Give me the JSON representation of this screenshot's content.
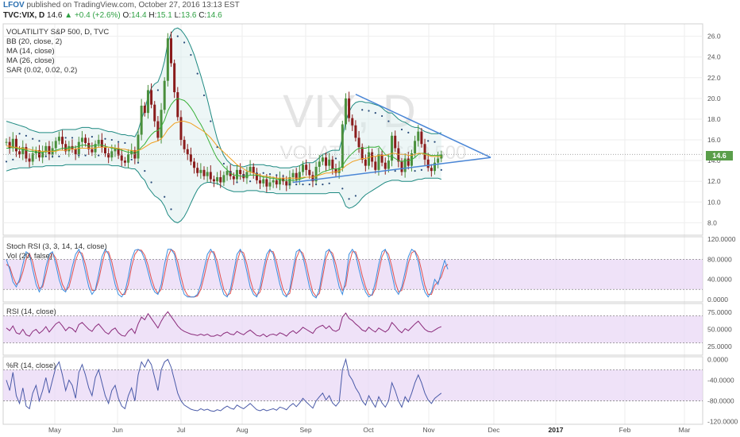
{
  "header": {
    "user": "LFOV",
    "published": "published on TradingView.com, October 27, 2016 13:13 EST",
    "symbol": "TVC:VIX, D",
    "last": "14.6",
    "change": "+0.4 (+2.6%)",
    "ohlc": {
      "o": "14.4",
      "h": "15.1",
      "l": "13.6",
      "c": "14.6"
    },
    "labels": {
      "o": "O:",
      "h": "H:",
      "l": "L:",
      "c": "C:"
    }
  },
  "main_pane": {
    "indicators": [
      "VOLATILITY S&P 500, D, TVC",
      "BB (20, close, 2)",
      "MA (14, close)",
      "MA (26, close)",
      "SAR (0.02, 0.02, 0.2)"
    ],
    "watermark": "VIX, D",
    "watermark_sub": "VOLATILITY S&P 500",
    "price_label": "14.6"
  },
  "stoch_pane": {
    "indicators": [
      "Stoch RSI (3, 3, 14, 14, close)",
      "Vol (20, false)"
    ]
  },
  "rsi_pane": {
    "indicators": [
      "RSI (14, close)"
    ]
  },
  "wr_pane": {
    "indicators": [
      "%R (14, close)"
    ]
  },
  "chart_data": [
    {
      "type": "candlestick",
      "title": "VOLATILITY S&P 500, D, TVC",
      "x_ticks": [
        "May",
        "Jun",
        "Jul",
        "Aug",
        "Sep",
        "Oct",
        "Nov",
        "Dec",
        "2017",
        "Feb",
        "Mar"
      ],
      "y_ticks": [
        "8.0",
        "10.0",
        "12.0",
        "14.0",
        "16.0",
        "18.0",
        "20.0",
        "22.0",
        "24.0",
        "26.0"
      ],
      "ylim": [
        6.8,
        27.2
      ],
      "close": [
        15.8,
        15.2,
        16.1,
        14.9,
        14.6,
        15.3,
        14.2,
        13.9,
        14.7,
        15.0,
        14.3,
        14.8,
        15.4,
        14.6,
        15.2,
        15.9,
        16.3,
        15.6,
        14.9,
        15.4,
        15.1,
        14.6,
        15.8,
        16.2,
        15.7,
        15.1,
        14.8,
        15.6,
        16.0,
        15.3,
        14.7,
        14.3,
        14.9,
        15.2,
        14.5,
        14.0,
        13.8,
        14.6,
        15.0,
        14.2,
        16.5,
        19.3,
        18.6,
        20.8,
        19.4,
        17.8,
        16.2,
        18.9,
        21.7,
        25.8,
        23.4,
        20.6,
        18.2,
        16.0,
        15.1,
        14.6,
        13.9,
        13.3,
        12.8,
        13.1,
        12.5,
        12.9,
        12.2,
        12.0,
        12.4,
        11.9,
        12.6,
        13.0,
        12.5,
        12.2,
        13.1,
        12.7,
        12.3,
        12.9,
        13.4,
        12.8,
        12.1,
        11.8,
        12.2,
        11.5,
        11.9,
        12.1,
        11.7,
        12.3,
        12.0,
        11.6,
        12.4,
        12.8,
        12.2,
        12.9,
        13.6,
        13.1,
        12.6,
        12.0,
        13.4,
        13.9,
        14.3,
        13.5,
        14.1,
        13.2,
        12.8,
        13.3,
        17.5,
        20.0,
        18.1,
        17.4,
        16.2,
        15.3,
        14.1,
        13.5,
        14.8,
        13.9,
        13.1,
        14.6,
        13.8,
        13.2,
        14.0,
        16.4,
        15.2,
        13.9,
        12.9,
        14.2,
        13.5,
        14.7,
        15.9,
        16.8,
        15.6,
        14.1,
        13.3,
        13.0,
        13.8,
        14.2,
        14.6
      ],
      "ma14": [
        15.2,
        15.2,
        15.3,
        15.2,
        15.1,
        15.1,
        15.0,
        14.9,
        14.9,
        14.8,
        14.8,
        14.8,
        14.9,
        14.9,
        14.9,
        15.0,
        15.1,
        15.2,
        15.2,
        15.2,
        15.3,
        15.3,
        15.4,
        15.5,
        15.5,
        15.4,
        15.4,
        15.5,
        15.5,
        15.5,
        15.4,
        15.3,
        15.2,
        15.2,
        15.1,
        15.0,
        14.9,
        14.8,
        14.8,
        14.7,
        14.9,
        15.3,
        15.6,
        16.1,
        16.5,
        16.8,
        16.9,
        17.3,
        17.9,
        18.8,
        19.4,
        19.8,
        20.0,
        19.9,
        19.8,
        19.5,
        19.1,
        18.6,
        18.0,
        17.5,
        16.9,
        16.2,
        15.5,
        14.8,
        14.2,
        13.8,
        13.4,
        13.1,
        12.8,
        12.6,
        12.6,
        12.5,
        12.5,
        12.5,
        12.6,
        12.6,
        12.6,
        12.5,
        12.4,
        12.4,
        12.3,
        12.3,
        12.2,
        12.2,
        12.1,
        12.1,
        12.1,
        12.1,
        12.1,
        12.2,
        12.3,
        12.4,
        12.4,
        12.4,
        12.5,
        12.7,
        12.9,
        13.0,
        13.1,
        13.2,
        13.2,
        13.2,
        13.5,
        14.0,
        14.4,
        14.7,
        15.0,
        15.2,
        15.2,
        15.2,
        15.3,
        15.3,
        15.3,
        15.4,
        15.0,
        14.6,
        14.4,
        14.4,
        14.2,
        14.0,
        13.9,
        14.0,
        14.0,
        14.1,
        14.3,
        14.6,
        14.7,
        14.7,
        14.6,
        14.5,
        14.5,
        14.5,
        14.5
      ],
      "ma26": [
        15.4,
        15.4,
        15.3,
        15.3,
        15.2,
        15.2,
        15.1,
        15.1,
        15.0,
        15.0,
        14.9,
        14.9,
        14.9,
        14.9,
        14.9,
        14.9,
        15.0,
        15.0,
        15.0,
        15.1,
        15.1,
        15.1,
        15.2,
        15.2,
        15.2,
        15.2,
        15.2,
        15.2,
        15.3,
        15.3,
        15.3,
        15.3,
        15.3,
        15.2,
        15.2,
        15.1,
        15.1,
        15.0,
        15.0,
        14.9,
        15.0,
        15.1,
        15.3,
        15.5,
        15.7,
        15.8,
        15.9,
        16.1,
        16.5,
        17.0,
        17.3,
        17.6,
        17.7,
        17.8,
        17.8,
        17.7,
        17.6,
        17.4,
        17.2,
        17.0,
        16.8,
        16.5,
        16.2,
        15.8,
        15.4,
        15.1,
        14.8,
        14.5,
        14.2,
        13.9,
        13.6,
        13.4,
        13.2,
        13.0,
        12.9,
        12.8,
        12.7,
        12.6,
        12.5,
        12.5,
        12.4,
        12.4,
        12.3,
        12.3,
        12.3,
        12.3,
        12.3,
        12.3,
        12.3,
        12.3,
        12.4,
        12.4,
        12.4,
        12.4,
        12.5,
        12.6,
        12.7,
        12.8,
        12.8,
        12.9,
        12.9,
        13.0,
        13.2,
        13.5,
        13.7,
        13.9,
        14.0,
        14.1,
        14.2,
        14.2,
        14.3,
        14.4,
        14.4,
        14.5,
        14.5,
        14.5,
        14.6,
        14.7,
        14.7,
        14.6,
        14.6,
        14.6,
        14.5,
        14.5,
        14.6,
        14.7,
        14.7,
        14.6,
        14.5,
        14.4,
        14.4,
        14.4,
        14.4
      ],
      "bb_upper": [
        17.8,
        17.7,
        17.6,
        17.5,
        17.4,
        17.3,
        17.2,
        17.0,
        16.9,
        16.8,
        16.7,
        16.7,
        16.7,
        16.7,
        16.7,
        16.8,
        16.9,
        17.0,
        17.0,
        17.0,
        17.0,
        17.0,
        17.1,
        17.2,
        17.2,
        17.2,
        17.1,
        17.1,
        17.1,
        17.0,
        16.9,
        16.8,
        16.8,
        16.7,
        16.6,
        16.5,
        16.5,
        16.4,
        16.4,
        16.3,
        16.9,
        18.0,
        18.9,
        20.2,
        21.0,
        21.4,
        21.6,
        22.4,
        23.6,
        25.4,
        26.3,
        26.7,
        26.8,
        26.6,
        26.2,
        25.7,
        25.0,
        24.2,
        23.2,
        22.2,
        21.1,
        19.9,
        18.6,
        17.3,
        16.1,
        15.2,
        14.5,
        14.0,
        13.7,
        13.5,
        13.5,
        13.4,
        13.4,
        13.5,
        13.6,
        13.6,
        13.6,
        13.6,
        13.6,
        13.5,
        13.5,
        13.4,
        13.4,
        13.3,
        13.3,
        13.3,
        13.3,
        13.4,
        13.4,
        13.5,
        13.7,
        13.8,
        13.8,
        13.8,
        14.0,
        14.3,
        14.6,
        14.7,
        14.9,
        15.0,
        15.0,
        15.0,
        16.2,
        17.8,
        18.7,
        19.3,
        19.6,
        19.7,
        19.7,
        19.6,
        19.6,
        19.5,
        19.4,
        19.3,
        19.1,
        18.8,
        18.6,
        18.6,
        18.3,
        18.0,
        17.8,
        17.7,
        17.5,
        17.3,
        17.2,
        17.2,
        17.0,
        16.8,
        16.7,
        16.6,
        16.6,
        16.6,
        16.7
      ],
      "bb_lower": [
        13.0,
        13.1,
        13.2,
        13.2,
        13.3,
        13.3,
        13.3,
        13.3,
        13.4,
        13.4,
        13.4,
        13.4,
        13.5,
        13.5,
        13.5,
        13.5,
        13.5,
        13.5,
        13.6,
        13.6,
        13.6,
        13.6,
        13.6,
        13.6,
        13.6,
        13.6,
        13.6,
        13.6,
        13.6,
        13.6,
        13.6,
        13.6,
        13.5,
        13.5,
        13.5,
        13.4,
        13.3,
        13.3,
        13.2,
        13.2,
        12.9,
        12.4,
        12.1,
        11.4,
        11.0,
        10.6,
        10.4,
        10.1,
        9.6,
        8.8,
        8.4,
        8.1,
        8.0,
        8.2,
        8.6,
        9.2,
        9.9,
        10.6,
        11.2,
        11.6,
        11.8,
        11.9,
        11.9,
        11.8,
        11.8,
        11.6,
        11.4,
        11.2,
        11.1,
        11.0,
        11.0,
        11.0,
        11.0,
        11.1,
        11.1,
        11.1,
        11.1,
        11.0,
        11.0,
        10.9,
        10.9,
        10.9,
        10.8,
        10.8,
        10.8,
        10.8,
        10.8,
        10.8,
        10.8,
        10.8,
        10.8,
        10.8,
        10.8,
        10.8,
        10.8,
        10.8,
        10.8,
        10.8,
        10.9,
        10.9,
        10.9,
        10.9,
        10.4,
        9.6,
        9.4,
        9.5,
        9.7,
        10.0,
        10.4,
        10.7,
        10.9,
        11.1,
        11.3,
        11.5,
        11.7,
        11.9,
        12.0,
        12.1,
        12.1,
        12.1,
        12.0,
        12.0,
        12.0,
        12.0,
        12.1,
        12.2,
        12.2,
        12.3,
        12.3,
        12.3,
        12.3,
        12.3,
        12.2
      ],
      "triangle": [
        {
          "from": [
            106,
            20.4
          ],
          "to": [
            147,
            14.3
          ]
        },
        {
          "from": [
            87,
            11.9
          ],
          "to": [
            147,
            14.3
          ]
        }
      ]
    },
    {
      "type": "line",
      "title": "Stoch RSI (3, 3, 14, 14, close)",
      "y_ticks": [
        "0.0000",
        "40.0000",
        "80.0000",
        "120.0000"
      ],
      "ylim": [
        -5,
        125
      ],
      "bands": [
        20,
        80
      ],
      "k": [
        80,
        60,
        35,
        25,
        40,
        70,
        95,
        90,
        60,
        30,
        15,
        30,
        65,
        90,
        95,
        70,
        40,
        20,
        15,
        35,
        65,
        90,
        100,
        85,
        55,
        25,
        10,
        20,
        50,
        85,
        100,
        90,
        60,
        30,
        10,
        5,
        15,
        45,
        80,
        98,
        100,
        95,
        80,
        55,
        30,
        15,
        10,
        30,
        70,
        100,
        100,
        90,
        60,
        30,
        10,
        5,
        5,
        5,
        10,
        30,
        60,
        90,
        100,
        90,
        60,
        30,
        10,
        5,
        20,
        55,
        90,
        100,
        85,
        55,
        25,
        10,
        5,
        25,
        60,
        90,
        100,
        90,
        60,
        30,
        10,
        5,
        20,
        60,
        95,
        100,
        85,
        55,
        25,
        8,
        3,
        20,
        60,
        95,
        100,
        85,
        55,
        25,
        10,
        40,
        90,
        100,
        90,
        60,
        35,
        15,
        5,
        10,
        35,
        70,
        95,
        100,
        80,
        50,
        20,
        10,
        25,
        55,
        85,
        100,
        95,
        75,
        40,
        15,
        5,
        15,
        40,
        30,
        55,
        78,
        60
      ],
      "d": [
        70,
        65,
        45,
        30,
        35,
        55,
        80,
        92,
        75,
        45,
        22,
        25,
        50,
        80,
        93,
        82,
        55,
        30,
        18,
        25,
        50,
        78,
        95,
        92,
        70,
        40,
        18,
        18,
        38,
        70,
        95,
        95,
        75,
        45,
        20,
        10,
        10,
        30,
        65,
        90,
        99,
        98,
        88,
        68,
        42,
        22,
        12,
        20,
        50,
        85,
        100,
        95,
        75,
        45,
        20,
        8,
        5,
        5,
        7,
        20,
        45,
        75,
        95,
        95,
        75,
        45,
        20,
        8,
        12,
        40,
        75,
        97,
        93,
        70,
        40,
        17,
        8,
        15,
        45,
        78,
        97,
        95,
        75,
        45,
        20,
        8,
        12,
        45,
        82,
        98,
        92,
        70,
        40,
        15,
        6,
        12,
        45,
        82,
        98,
        92,
        70,
        40,
        18,
        28,
        70,
        95,
        95,
        75,
        48,
        25,
        10,
        8,
        22,
        55,
        85,
        98,
        90,
        65,
        35,
        15,
        18,
        42,
        72,
        93,
        97,
        85,
        58,
        28,
        10,
        10,
        28,
        35,
        45,
        65,
        70
      ]
    },
    {
      "type": "line",
      "title": "RSI (14, close)",
      "y_ticks": [
        "25.0000",
        "50.0000",
        "75.0000"
      ],
      "ylim": [
        12,
        88
      ],
      "bands": [
        30,
        70
      ],
      "values": [
        52,
        48,
        55,
        45,
        43,
        50,
        42,
        40,
        47,
        50,
        44,
        48,
        54,
        46,
        52,
        58,
        61,
        55,
        48,
        53,
        51,
        46,
        57,
        60,
        55,
        50,
        47,
        54,
        58,
        52,
        46,
        43,
        49,
        52,
        45,
        41,
        40,
        47,
        51,
        44,
        58,
        68,
        64,
        73,
        66,
        59,
        52,
        62,
        70,
        76,
        69,
        62,
        55,
        50,
        47,
        45,
        43,
        42,
        41,
        43,
        41,
        43,
        40,
        40,
        42,
        40,
        44,
        46,
        43,
        42,
        47,
        44,
        42,
        46,
        49,
        45,
        41,
        40,
        43,
        39,
        42,
        43,
        41,
        45,
        43,
        40,
        45,
        48,
        44,
        48,
        53,
        50,
        47,
        44,
        51,
        54,
        56,
        51,
        55,
        49,
        47,
        50,
        68,
        74,
        66,
        63,
        58,
        54,
        49,
        47,
        53,
        49,
        46,
        52,
        49,
        46,
        50,
        60,
        55,
        49,
        45,
        51,
        48,
        53,
        58,
        62,
        56,
        50,
        47,
        46,
        49,
        52,
        54
      ]
    },
    {
      "type": "line",
      "title": "%R (14, close)",
      "y_ticks": [
        "-120.0000",
        "-80.0000",
        "-40.0000",
        "0.0000"
      ],
      "ylim": [
        -125,
        5
      ],
      "bands": [
        -80,
        -20
      ],
      "values": [
        -40,
        -60,
        -25,
        -70,
        -85,
        -55,
        -90,
        -95,
        -65,
        -50,
        -80,
        -60,
        -35,
        -65,
        -40,
        -15,
        -5,
        -30,
        -60,
        -40,
        -50,
        -75,
        -25,
        -10,
        -30,
        -55,
        -70,
        -35,
        -20,
        -45,
        -70,
        -85,
        -60,
        -50,
        -75,
        -90,
        -95,
        -70,
        -55,
        -80,
        -30,
        -5,
        -15,
        0,
        -10,
        -35,
        -60,
        -20,
        -5,
        0,
        -15,
        -40,
        -65,
        -80,
        -88,
        -92,
        -96,
        -98,
        -99,
        -95,
        -98,
        -96,
        -99,
        -100,
        -97,
        -99,
        -94,
        -90,
        -94,
        -96,
        -88,
        -92,
        -95,
        -90,
        -85,
        -91,
        -97,
        -99,
        -96,
        -99,
        -97,
        -95,
        -98,
        -92,
        -94,
        -97,
        -90,
        -85,
        -91,
        -84,
        -75,
        -82,
        -88,
        -94,
        -80,
        -72,
        -65,
        -78,
        -70,
        -84,
        -90,
        -82,
        -20,
        0,
        -30,
        -40,
        -55,
        -65,
        -80,
        -88,
        -70,
        -82,
        -92,
        -72,
        -84,
        -92,
        -80,
        -45,
        -60,
        -80,
        -92,
        -72,
        -82,
        -65,
        -45,
        -30,
        -45,
        -65,
        -78,
        -85,
        -75,
        -70,
        -65
      ]
    }
  ]
}
